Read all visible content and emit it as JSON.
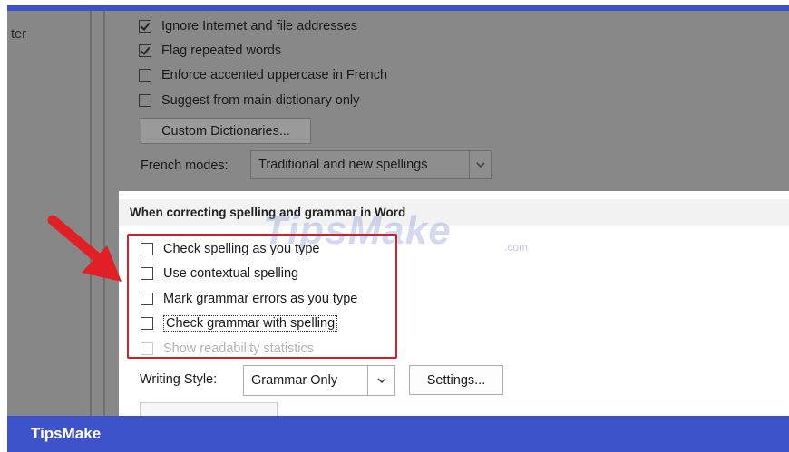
{
  "sidebar": {
    "partial_label": "ter"
  },
  "top_options": [
    {
      "label": "Ignore Internet and file addresses",
      "checked": true
    },
    {
      "label": "Flag repeated words",
      "checked": true
    },
    {
      "label": "Enforce accented uppercase in French",
      "checked": false
    },
    {
      "label": "Suggest from main dictionary only",
      "checked": false
    }
  ],
  "custom_dictionaries_button": "Custom Dictionaries...",
  "french_modes": {
    "label": "French modes:",
    "value": "Traditional and new spellings"
  },
  "section": {
    "title": "When correcting spelling and grammar in Word"
  },
  "grammar_options": [
    {
      "label": "Check spelling as you type",
      "checked": false
    },
    {
      "label": "Use contextual spelling",
      "checked": false
    },
    {
      "label": "Mark grammar errors as you type",
      "checked": false
    },
    {
      "label": "Check grammar with spelling",
      "checked": false
    },
    {
      "label": "Show readability statistics",
      "checked": false,
      "disabled": true
    }
  ],
  "writing_style": {
    "label": "Writing Style:",
    "value": "Grammar Only"
  },
  "settings_button": "Settings...",
  "watermark": {
    "text": "TipsMake",
    "suffix": ".com"
  },
  "footer": {
    "brand": "TipsMake"
  },
  "colors": {
    "accent": "#3d51c8",
    "highlight": "#c8242e",
    "dim_overlay": "#888888"
  }
}
